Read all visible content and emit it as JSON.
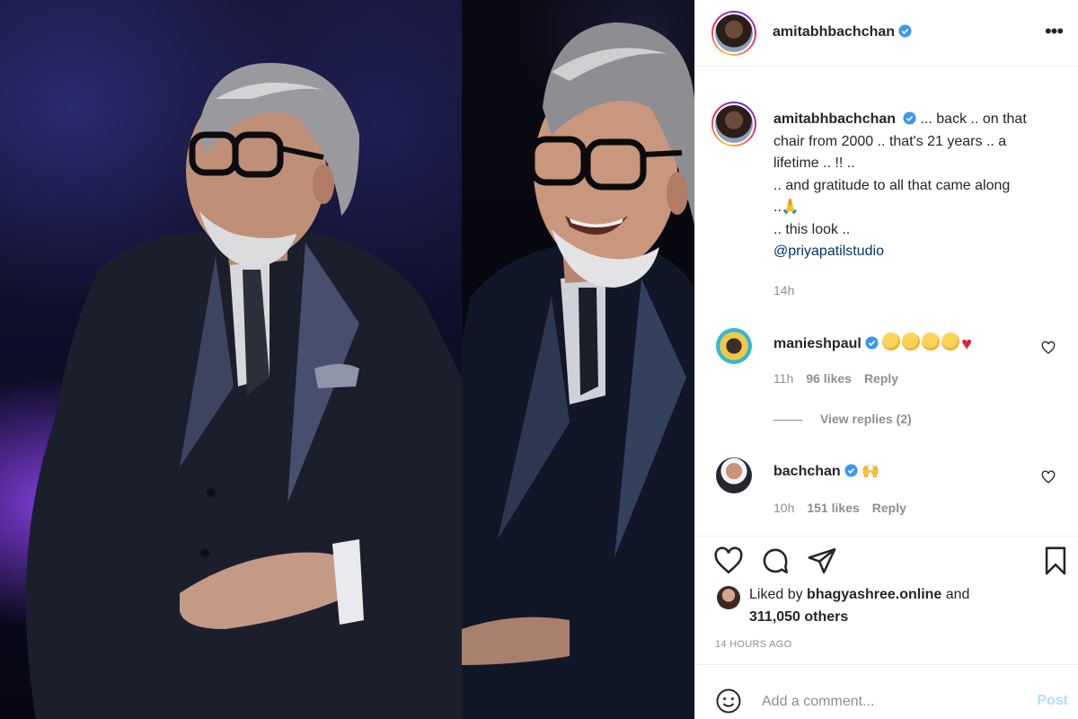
{
  "post": {
    "username": "amitabhbachchan",
    "verified": true
  },
  "caption": {
    "username": "amitabhbachchan",
    "line1": "... back .. on that",
    "line2": "chair from 2000 .. that's 21 years .. a",
    "line3": "lifetime .. !! ..",
    "line4": ".. and gratitude to all that came along",
    "line5": "..",
    "line6": ".. this look ..",
    "mention": "@priyapatilstudio",
    "time": "14h"
  },
  "comments": [
    {
      "username": "manieshpaul",
      "verified": true,
      "emojis": [
        "clap",
        "clap",
        "clap",
        "clap",
        "heart"
      ],
      "time": "11h",
      "likes": "96 likes",
      "reply": "Reply",
      "view_replies": "View replies (2)"
    },
    {
      "username": "bachchan",
      "verified": true,
      "emojis": [
        "raising-hands"
      ],
      "time": "10h",
      "likes": "151 likes",
      "reply": "Reply"
    }
  ],
  "actions": {
    "liked_by_prefix": "Liked by ",
    "liked_by_user": "bhagyashree.online",
    "liked_by_and": " and",
    "others": "311,050 others",
    "posted_ago": "14 HOURS AGO"
  },
  "add_comment": {
    "placeholder": "Add a comment...",
    "post_label": "Post"
  },
  "colors": {
    "verified_blue": "#3897f0",
    "link_blue": "#00376b",
    "post_button_disabled": "#b2dffc",
    "muted_text": "#8e8e8e"
  },
  "icons": [
    "more-options-icon",
    "heart-icon",
    "comment-icon",
    "share-icon",
    "bookmark-icon",
    "smiley-icon",
    "verified-badge-icon"
  ]
}
